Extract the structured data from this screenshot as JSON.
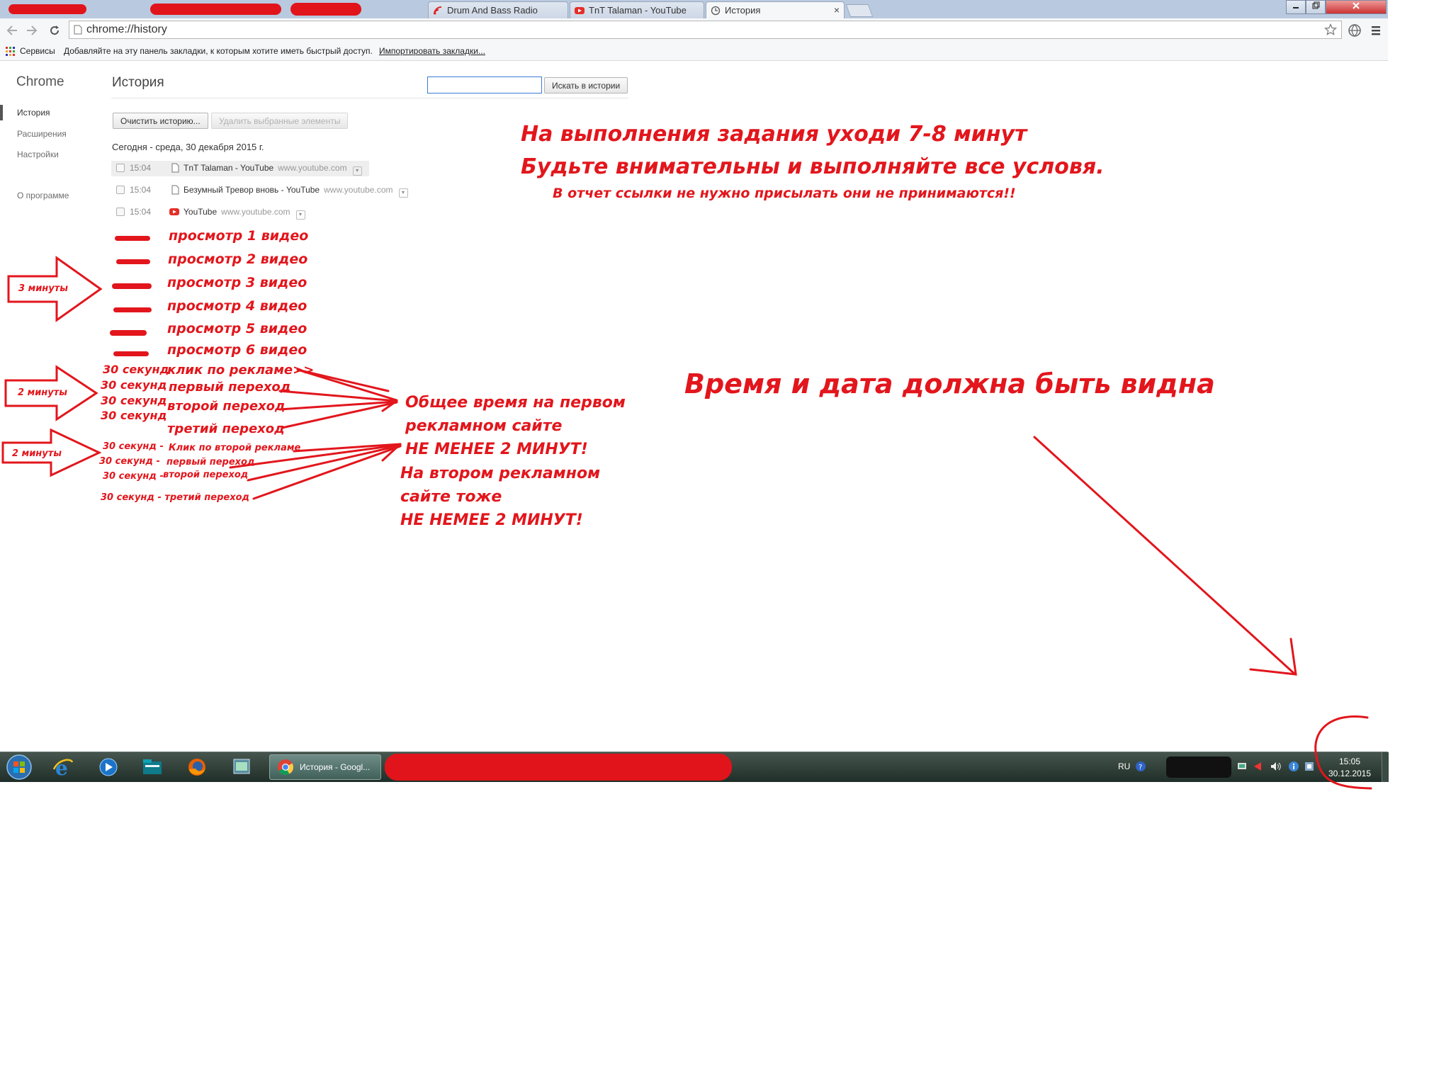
{
  "tabs": [
    {
      "label": "Drum And Bass Radio"
    },
    {
      "label": "TnT Talaman - YouTube"
    },
    {
      "label": "История",
      "close": "×"
    }
  ],
  "toolbar": {
    "url": "chrome://history"
  },
  "bookmarks": {
    "apps_label": "Сервисы",
    "hint": "Добавляйте на эту панель закладки, к которым хотите иметь быстрый доступ.",
    "import_link": "Импортировать закладки..."
  },
  "sidebar": {
    "title": "Chrome",
    "items": [
      {
        "label": "История"
      },
      {
        "label": "Расширения"
      },
      {
        "label": "Настройки"
      },
      {
        "label": "О программе"
      }
    ]
  },
  "history": {
    "title": "История",
    "search_placeholder": "",
    "search_button": "Искать в истории",
    "clear_button": "Очистить историю...",
    "delete_button": "Удалить выбранные элементы",
    "date_heading": "Сегодня - среда, 30 декабря 2015 г.",
    "entries": [
      {
        "time": "15:04",
        "title": "TnT Talaman - YouTube",
        "domain": "www.youtube.com"
      },
      {
        "time": "15:04",
        "title": "Безумный Тревор вновь - YouTube",
        "domain": "www.youtube.com"
      },
      {
        "time": "15:04",
        "title": "YouTube",
        "domain": "www.youtube.com"
      }
    ]
  },
  "annotations": {
    "headline1": "На выполнения задания уходи 7-8 минут",
    "headline2": "Будьте внимательны и выполняйте все условя.",
    "note": "В отчет ссылки не нужно присылать они не принимаются!!",
    "views": [
      "просмотр 1 видео",
      "просмотр 2 видео",
      "просмотр 3 видео",
      "просмотр 4 видео",
      "просмотр 5 видео",
      "просмотр 6 видео"
    ],
    "arrow1": "3 минуты",
    "arrow2": "2 минуты",
    "arrow3": "2 минуты",
    "g1_times": [
      "30 секунд",
      "30 секунд",
      "30 секунд",
      "30 секунд"
    ],
    "g1_steps": [
      "клик по рекламе>>",
      "первый переход",
      "второй переход",
      "третий переход"
    ],
    "g2_rows": [
      "30 секунд -",
      "30 секунд -",
      "30 секунд -",
      "30 секунд - третий переход"
    ],
    "g2_steps": [
      "Клик по второй рекламе",
      "первый переход",
      "второй переход"
    ],
    "total_lines": [
      "Общее время на первом",
      "рекламном сайте",
      "НЕ МЕНЕЕ 2 МИНУТ!",
      "На втором рекламном",
      "сайте тоже",
      "НЕ НЕМЕЕ 2 МИНУТ!"
    ],
    "visible": "Время и дата должна быть видна"
  },
  "taskbar": {
    "chrome_label": "История - Googl...",
    "lang": "RU",
    "clock_time": "15:05",
    "clock_date": "30.12.2015"
  },
  "colors": {
    "annotation_red": "#e2161c",
    "taskbar": "#2d3d36",
    "tab_strip": "#b9c9df"
  }
}
